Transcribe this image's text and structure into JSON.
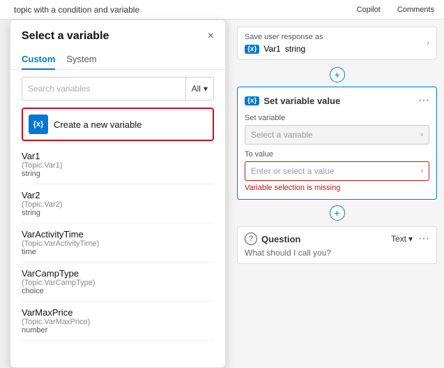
{
  "topbar": {
    "title": "topic with a condition and variable",
    "copilot_label": "Copilot",
    "comments_label": "Comments"
  },
  "panel": {
    "title": "Select a variable",
    "close_icon": "×",
    "tabs": [
      {
        "label": "Custom",
        "active": true
      },
      {
        "label": "System",
        "active": false
      }
    ],
    "search": {
      "placeholder": "Search variables",
      "filter_label": "All",
      "dropdown_icon": "▾"
    },
    "create_button": {
      "icon_text": "{x}",
      "label": "Create a new variable"
    },
    "variables": [
      {
        "name": "Var1",
        "topic": "(Topic.Var1)",
        "type": "string"
      },
      {
        "name": "Var2",
        "topic": "(Topic.Var2)",
        "type": "string"
      },
      {
        "name": "VarActivityTime",
        "topic": "(Topic.VarActivityTime)",
        "type": "time"
      },
      {
        "name": "VarCampType",
        "topic": "(Topic.VarCampType)",
        "type": "choice"
      },
      {
        "name": "VarMaxPrice",
        "topic": "(Topic.VarMaxPrice)",
        "type": "number"
      }
    ]
  },
  "right": {
    "save_response": {
      "label": "Save user response as",
      "var_badge": "{x}",
      "var_name": "Var1",
      "var_type": "string"
    },
    "set_variable_card": {
      "var_badge": "{x}",
      "title": "Set variable value",
      "set_variable_label": "Set variable",
      "set_variable_placeholder": "Select a variable",
      "to_value_label": "To value",
      "to_value_placeholder": "Enter or select a value",
      "error_text": "Variable selection is missing"
    },
    "question_card": {
      "icon": "?",
      "title": "Question",
      "type_label": "Text",
      "dropdown_icon": "▾",
      "menu_dots": "···",
      "content": "What should I call you?"
    }
  }
}
